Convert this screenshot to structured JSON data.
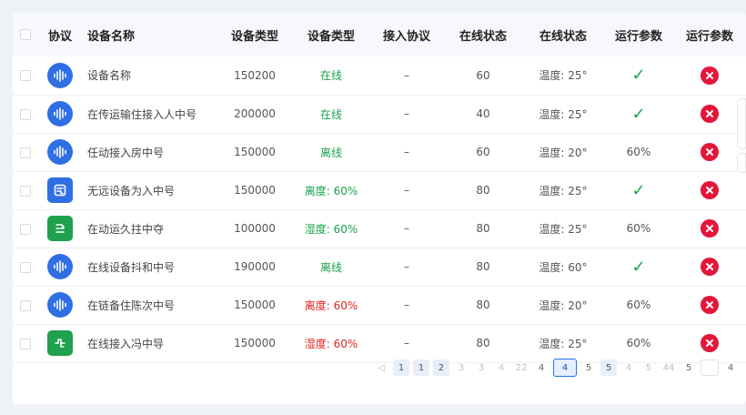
{
  "table": {
    "headers": {
      "protocol": "协议",
      "name": "设备名称",
      "type1": "设备类型",
      "type2": "设备类型",
      "access": "接入协议",
      "online1": "在线状态",
      "online2": "在线状态",
      "param1": "运行参数",
      "param2": "运行参数"
    },
    "rows": [
      {
        "icon": "audio-wave-icon",
        "name": "设备名称",
        "type": "150200",
        "status": "在线",
        "access": "–",
        "online": "60",
        "temp": "温度: 25°",
        "param": "✓"
      },
      {
        "icon": "audio-wave-icon",
        "name": "在传运输住接入人中号",
        "type": "200000",
        "status": "在线",
        "access": "–",
        "online": "40",
        "temp": "温度: 25°",
        "param": "✓"
      },
      {
        "icon": "audio-wave-icon",
        "name": "任动接入房中号",
        "type": "150000",
        "status": "离线",
        "access": "–",
        "online": "60",
        "temp": "温度: 20°",
        "param": "60%"
      },
      {
        "icon": "device-card-icon",
        "name": "无远设备为入中号",
        "type": "150000",
        "status": "离度: 60%",
        "access": "–",
        "online": "80",
        "temp": "温度: 25°",
        "param": "✓"
      },
      {
        "icon": "device-link-icon",
        "name": "在动运久拄中夺",
        "type": "100000",
        "status": "湿度: 60%",
        "access": "–",
        "online": "80",
        "temp": "温度: 25°",
        "param": "60%"
      },
      {
        "icon": "audio-wave-icon",
        "name": "在线设备抖和中号",
        "type": "190000",
        "status": "离线",
        "access": "–",
        "online": "80",
        "temp": "温度: 60°",
        "param": "✓"
      },
      {
        "icon": "audio-wave-icon",
        "name": "在链备住陈次中号",
        "type": "150000",
        "status": "离度: 60%",
        "access": "–",
        "online": "80",
        "temp": "温度: 20°",
        "param": "60%"
      },
      {
        "icon": "device-plug-icon",
        "name": "在线接入冯中导",
        "type": "150000",
        "status": "湿度: 60%",
        "access": "–",
        "online": "80",
        "temp": "温度: 25°",
        "param": "60%"
      }
    ]
  },
  "pagination": {
    "items": [
      "1",
      "1",
      "2",
      "3",
      "3",
      "4",
      "22",
      "4",
      "4",
      "5",
      "5",
      "4",
      "5",
      "44",
      "5",
      "4"
    ]
  },
  "colors": {
    "accent": "#2f6fe4",
    "green": "#1aa34a",
    "red": "#e02424",
    "delete": "#e4163a"
  }
}
